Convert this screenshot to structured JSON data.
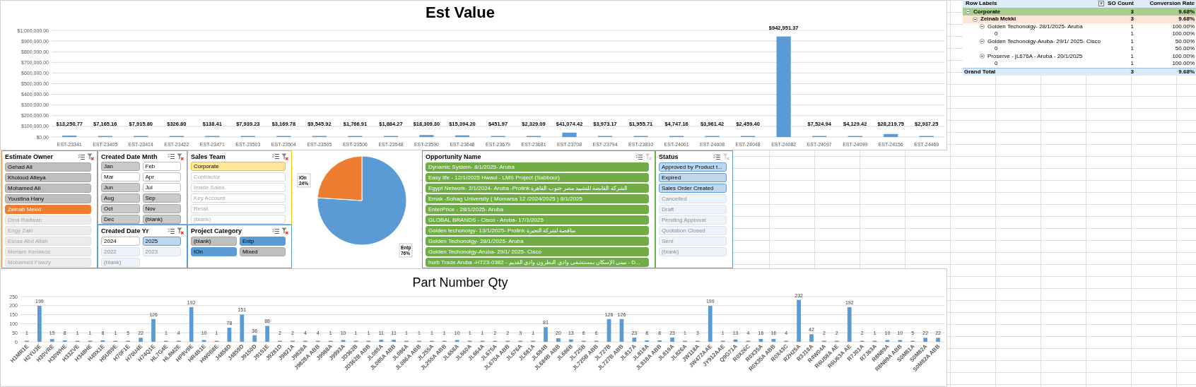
{
  "est_chart": {
    "chart_data": {
      "type": "bar",
      "title": "Est Value",
      "categories": [
        "EST-23341",
        "EST-23405",
        "EST-23414",
        "EST-23422",
        "EST-23471",
        "EST-23503",
        "EST-23504",
        "EST-23505",
        "EST-23506",
        "EST-23548",
        "EST-23590",
        "EST-23648",
        "EST-23679",
        "EST-23681",
        "EST-23708",
        "EST-23794",
        "EST-23810",
        "EST-24001",
        "EST-24008",
        "EST-24048",
        "EST-24082",
        "EST-24097",
        "EST-24099",
        "EST-24156",
        "EST-24469"
      ],
      "values": [
        13250.77,
        7165.16,
        7915.8,
        326.8,
        138.41,
        7939.23,
        3169.78,
        9545.92,
        1766.91,
        1884.27,
        18309.3,
        15394.2,
        451.97,
        2329.09,
        41074.42,
        3973.17,
        1955.71,
        4747.16,
        3961.42,
        2459.4,
        942951.37,
        7524.94,
        4129.42,
        28219.75,
        2937.25
      ],
      "grid": true,
      "value_labels": [
        "$13,250.77",
        "$7,165.16",
        "$7,915.80",
        "$326.80",
        "$138.41",
        "$7,939.23",
        "$3,169.78",
        "$9,545.92",
        "$1,766.91",
        "$1,884.27",
        "$18,309.30",
        "$15,394.20",
        "$451.97",
        "$2,329.09",
        "$41,074.42",
        "$3,973.17",
        "$1,955.71",
        "$4,747.16",
        "$3,961.42",
        "$2,459.40",
        "$942,951.37",
        "$7,524.94",
        "$4,129.42",
        "$28,219.75",
        "$2,937.25"
      ],
      "ylim": [
        0,
        1000000
      ],
      "yticks": [
        {
          "value": 0,
          "label": "$0.00"
        },
        {
          "value": 100000,
          "label": "$100,000.00"
        },
        {
          "value": 200000,
          "label": "$200,000.00"
        },
        {
          "value": 300000,
          "label": "$300,000.00"
        },
        {
          "value": 400000,
          "label": "$400,000.00"
        },
        {
          "value": 500000,
          "label": "$500,000.00"
        },
        {
          "value": 600000,
          "label": "$600,000.00"
        },
        {
          "value": 700000,
          "label": "$700,000.00"
        },
        {
          "value": 800000,
          "label": "$800,000.00"
        },
        {
          "value": 900000,
          "label": "$900,000.00"
        },
        {
          "value": 1000000,
          "label": "$1,000,000.00"
        }
      ]
    }
  },
  "pivot": {
    "columns": [
      "Row Labels",
      "SO Count",
      "Conversion Rate"
    ],
    "rows": [
      {
        "label": "Corporate",
        "so_count": "3",
        "rate": "9.68%",
        "expanded": true,
        "children": [
          {
            "label": "Zeinab Mekki",
            "so_count": "3",
            "rate": "9.68%",
            "expanded": true,
            "children": [
              {
                "label": "Golden Techonolgy- 28/1/2025- Aruba",
                "so_count": "1",
                "rate": "100.00%",
                "expanded": true,
                "children": [
                  {
                    "label": "0",
                    "so_count": "1",
                    "rate": "100.00%"
                  }
                ]
              },
              {
                "label": "Golden Techonolgy-Aruba- 29/1/ 2025- Cisco",
                "so_count": "1",
                "rate": "50.00%",
                "expanded": true,
                "children": [
                  {
                    "label": "0",
                    "so_count": "1",
                    "rate": "50.00%"
                  }
                ]
              },
              {
                "label": "Proserve - jL676A - Aruba - 20/1/2025",
                "so_count": "1",
                "rate": "100.00%",
                "expanded": true,
                "children": [
                  {
                    "label": "0",
                    "so_count": "1",
                    "rate": "100.00%"
                  }
                ]
              }
            ]
          }
        ]
      }
    ],
    "grand_total": {
      "label": "Grand Total",
      "so_count": "3",
      "rate": "9.68%"
    }
  },
  "slicers": [
    {
      "title": "Estimate Owner",
      "color": "#ed7d31",
      "filtered": true,
      "items": [
        {
          "label": "Gehad Ali",
          "selected": false,
          "has_data": true
        },
        {
          "label": "Kholoud Atteya",
          "selected": false,
          "has_data": true
        },
        {
          "label": "Mohamed Ali",
          "selected": false,
          "has_data": true
        },
        {
          "label": "Youstina Hany",
          "selected": false,
          "has_data": true
        },
        {
          "label": "Zeinab Mekki",
          "selected": true,
          "has_data": true
        },
        {
          "label": "Dina Radwan",
          "selected": false,
          "has_data": false
        },
        {
          "label": "Engy Zaki",
          "selected": false,
          "has_data": false
        },
        {
          "label": "Esraa Abd Allah",
          "selected": false,
          "has_data": false
        },
        {
          "label": "Meriam Keriakos",
          "selected": false,
          "has_data": false
        },
        {
          "label": "Mohamed Fawzy",
          "selected": false,
          "has_data": false
        }
      ]
    },
    {
      "title": "Created Date Mnth",
      "color": "#a5a5a5",
      "filtered": true,
      "items": [
        {
          "label": "Jan",
          "selected": true,
          "has_data": true
        },
        {
          "label": "Feb",
          "selected": false,
          "has_data": true
        },
        {
          "label": "Mar",
          "selected": false,
          "has_data": true
        },
        {
          "label": "Apr",
          "selected": false,
          "has_data": true
        },
        {
          "label": "Jun",
          "selected": true,
          "has_data": true
        },
        {
          "label": "Jul",
          "selected": false,
          "has_data": true
        },
        {
          "label": "Aug",
          "selected": true,
          "has_data": true
        },
        {
          "label": "Sep",
          "selected": true,
          "has_data": true
        },
        {
          "label": "Oct",
          "selected": true,
          "has_data": true
        },
        {
          "label": "Nov",
          "selected": true,
          "has_data": true
        },
        {
          "label": "Dec",
          "selected": true,
          "has_data": true
        },
        {
          "label": "(blank)",
          "selected": true,
          "has_data": true
        }
      ]
    },
    {
      "title": "Created Date Yr",
      "color": "#5b9bd5",
      "filtered": true,
      "items": [
        {
          "label": "2024",
          "selected": false,
          "has_data": true
        },
        {
          "label": "2025",
          "selected": true,
          "has_data": true
        },
        {
          "label": "2022",
          "selected": false,
          "has_data": false
        },
        {
          "label": "2023",
          "selected": false,
          "has_data": false
        },
        {
          "label": "(blank)",
          "selected": false,
          "has_data": false
        }
      ]
    },
    {
      "title": "Sales Team",
      "color": "#ffc000",
      "filtered": true,
      "items": [
        {
          "label": "Corporate",
          "selected": true,
          "has_data": true
        },
        {
          "label": "Contractor",
          "selected": false,
          "has_data": false
        },
        {
          "label": "Inside Sales",
          "selected": false,
          "has_data": false
        },
        {
          "label": "Key Account",
          "selected": false,
          "has_data": false
        },
        {
          "label": "Retail",
          "selected": false,
          "has_data": false
        },
        {
          "label": "(blank)",
          "selected": false,
          "has_data": false
        }
      ]
    },
    {
      "title": "Project Category",
      "color": "#5b9bd5",
      "filtered": true,
      "items": [
        {
          "label": "(blank)",
          "selected": false,
          "has_data": true
        },
        {
          "label": "Entp",
          "selected": true,
          "has_data": true
        },
        {
          "label": "IOn",
          "selected": true,
          "has_data": true
        },
        {
          "label": "Mixed",
          "selected": false,
          "has_data": true
        }
      ]
    },
    {
      "title": "Opportunity Name",
      "color": "#70ad47",
      "filtered": false,
      "items": [
        {
          "label": "Dynamic System- 8/1/2025- Aruba",
          "selected": true,
          "has_data": true
        },
        {
          "label": "Easy life - 12/1/2025 Hwaui - LMS Project (Sabbour)",
          "selected": true,
          "has_data": true
        },
        {
          "label": "Egypt Network- 2/1/2024- Aruba -Prolink الشركة القابضة للتشييد مصر جنوب القاهرة",
          "selected": true,
          "has_data": true
        },
        {
          "label": "Emak -Sohag University ( Momarsa 12 /2024/2025 ) 8/1/2025",
          "selected": true,
          "has_data": true
        },
        {
          "label": "EnterPrice - 28/1/2025- Aruba",
          "selected": true,
          "has_data": true
        },
        {
          "label": "GLOBAL BRANDS - Cisco - Aruba- 17/1/2025",
          "selected": true,
          "has_data": true
        },
        {
          "label": "Golden techonolgy- 13/1/2025- Prolink مناقصة لشركة التجيرة",
          "selected": true,
          "has_data": true
        },
        {
          "label": "Golden Techonolgy- 28/1/2025- Aruba",
          "selected": true,
          "has_data": true
        },
        {
          "label": "Golden Techonolgy-Aruba- 29/1/ 2025- Cisco",
          "selected": true,
          "has_data": true
        },
        {
          "label": "hurb Trade Aruba -HT23-0382 - مبنى الإسكان بمستشفى وادي النطرون وادي القديم - D...",
          "selected": true,
          "has_data": true
        }
      ]
    },
    {
      "title": "Status",
      "color": "#5b9bd5",
      "filtered": false,
      "items": [
        {
          "label": "Approved by Product t...",
          "selected": true,
          "has_data": true
        },
        {
          "label": "Expired",
          "selected": true,
          "has_data": true
        },
        {
          "label": "Sales Order Created",
          "selected": true,
          "has_data": true
        },
        {
          "label": "Cancelled",
          "selected": false,
          "has_data": false
        },
        {
          "label": "Draft",
          "selected": false,
          "has_data": false
        },
        {
          "label": "Pending Approval",
          "selected": false,
          "has_data": false
        },
        {
          "label": "Quotation Closed",
          "selected": false,
          "has_data": false
        },
        {
          "label": "Sent",
          "selected": false,
          "has_data": false
        },
        {
          "label": "(blank)",
          "selected": false,
          "has_data": false
        }
      ]
    }
  ],
  "pie": {
    "chart_data": {
      "type": "pie",
      "categories": [
        "Entp",
        "IOn"
      ],
      "values": [
        76,
        24
      ],
      "value_labels": [
        "76%",
        "24%"
      ],
      "data_labels": true
    }
  },
  "part_chart": {
    "chart_data": {
      "type": "bar",
      "title": "Part Number Qty",
      "categories": [
        "H1MR1E",
        "H2YU3E",
        "H30VRE",
        "H30WHE",
        "H33ZVE",
        "H348HE",
        "H49X1E",
        "H5UB9E",
        "H70F1E",
        "H70U4E",
        "H74Q1E",
        "HL7G4E",
        "HL8M2E",
        "HP9V9E",
        "HR4B1E",
        "HW0B8E",
        "J4858D",
        "J4859D",
        "J9150D",
        "J9151E",
        "J9281D",
        "J9821A",
        "J9828A",
        "J9828A ABB",
        "J9988A",
        "J9993A",
        "JD362B",
        "JD362B ABB",
        "JL085A",
        "JL085A ABB",
        "JL086A",
        "JL086A ABB",
        "JL255A",
        "JL255A ABB",
        "JL658A",
        "JL660A",
        "JL664A",
        "JL675A",
        "JL675A ABB",
        "JL676A",
        "JL681A",
        "JL684B",
        "JL684B ABB",
        "JL686B",
        "JL725B",
        "JL725B ABB",
        "JL727B",
        "JL727B ABB",
        "JL817A",
        "JL818A",
        "JL818A ABB",
        "JL819A",
        "JL826A",
        "JW118A",
        "JW472AAE",
        "JY912AAE",
        "Q9G71A",
        "R0X26C",
        "R0X35A",
        "R0X35A ABB",
        "R0X43C",
        "R2H25A",
        "R3J18A",
        "R4W04A",
        "R6U58A AE",
        "R6U63A AE",
        "R7J01A",
        "R7J63A",
        "R8N89A",
        "R8N89A ABB",
        "S0M81A",
        "S0M82A",
        "S0M82A ABB"
      ],
      "values": [
        1,
        199,
        15,
        8,
        1,
        1,
        8,
        1,
        5,
        22,
        126,
        1,
        4,
        192,
        10,
        1,
        78,
        151,
        36,
        88,
        2,
        2,
        4,
        4,
        1,
        10,
        1,
        1,
        11,
        11,
        1,
        1,
        1,
        1,
        10,
        1,
        1,
        2,
        2,
        3,
        1,
        81,
        20,
        13,
        6,
        6,
        126,
        126,
        23,
        8,
        8,
        23,
        1,
        3,
        199,
        1,
        13,
        4,
        16,
        16,
        4,
        232,
        42,
        2,
        2,
        192,
        2,
        1,
        10,
        10,
        5,
        22,
        22
      ],
      "grid": true,
      "data_labels": true,
      "ylim": [
        0,
        250
      ],
      "yticks": [
        0,
        50,
        100,
        150,
        200,
        250
      ]
    }
  }
}
